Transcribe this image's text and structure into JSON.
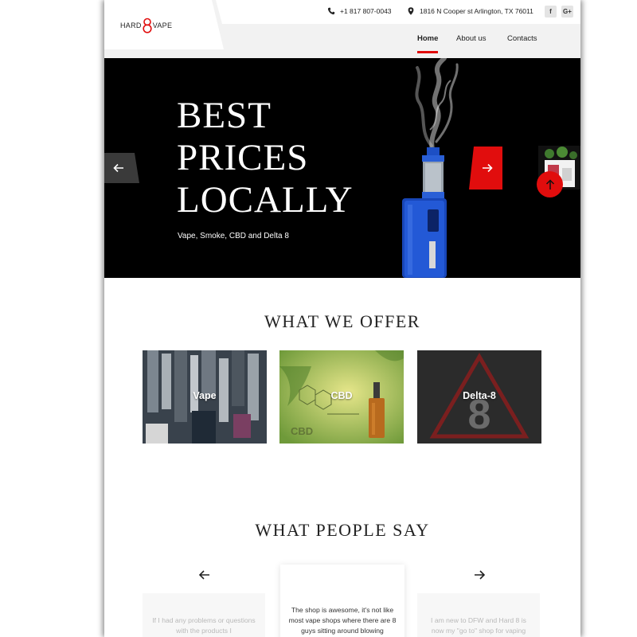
{
  "header": {
    "logo": {
      "left_text": "HARD",
      "right_text": "VAPE"
    },
    "phone": "+1 817 807-0043",
    "address": "1816 N Cooper st Arlington, TX 76011",
    "social": {
      "facebook": "f",
      "google_plus": "G+"
    },
    "nav": {
      "home": "Home",
      "about": "About us",
      "contacts": "Contacts"
    },
    "active_nav": "Home"
  },
  "hero": {
    "title": "BEST PRICES LOCALLY",
    "subtitle": "Vape, Smoke, CBD and Delta 8"
  },
  "offer": {
    "title": "WHAT WE OFFER",
    "cards": [
      {
        "label": "Vape"
      },
      {
        "label": "CBD"
      },
      {
        "label": "Delta-8"
      }
    ]
  },
  "testimonials": {
    "title": "WHAT PEOPLE SAY",
    "items": [
      {
        "text": "If I had any problems or questions with the products I"
      },
      {
        "text": "The shop is awesome, it's not like most vape shops where there are 8 guys sitting around blowing"
      },
      {
        "text": "I am new to DFW and Hard 8 is now my \"go to\" shop for vaping"
      }
    ]
  },
  "colors": {
    "accent": "#e10d0d",
    "hero_bg": "#000000",
    "header_bg": "#f2f2f2"
  }
}
